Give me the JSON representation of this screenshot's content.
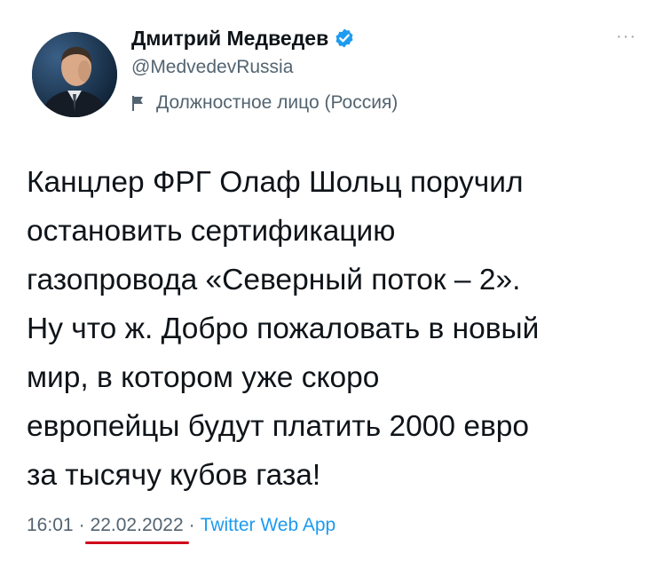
{
  "author": {
    "display_name": "Дмитрий Медведев",
    "handle": "@MedvedevRussia",
    "label": "Должностное лицо (Россия)",
    "verified": true
  },
  "icons": {
    "verified": "verified-badge-icon",
    "label": "flag-icon",
    "more": "more-options-icon",
    "more_glyph": "···"
  },
  "tweet": {
    "lines": [
      "Канцлер ФРГ Олаф Шольц поручил",
      "остановить сертификацию",
      "газопровода «Северный поток – 2».",
      "Ну что ж. Добро пожаловать в новый",
      "мир, в котором уже скоро",
      "европейцы будут платить 2000 евро",
      "за тысячу кубов газа!"
    ]
  },
  "meta": {
    "time": "16:01",
    "separator": "·",
    "date": "22.02.2022",
    "source": "Twitter Web App"
  },
  "colors": {
    "text": "#0f1419",
    "secondary": "#536471",
    "accent": "#1d9bf0",
    "underline": "#d0021b"
  }
}
